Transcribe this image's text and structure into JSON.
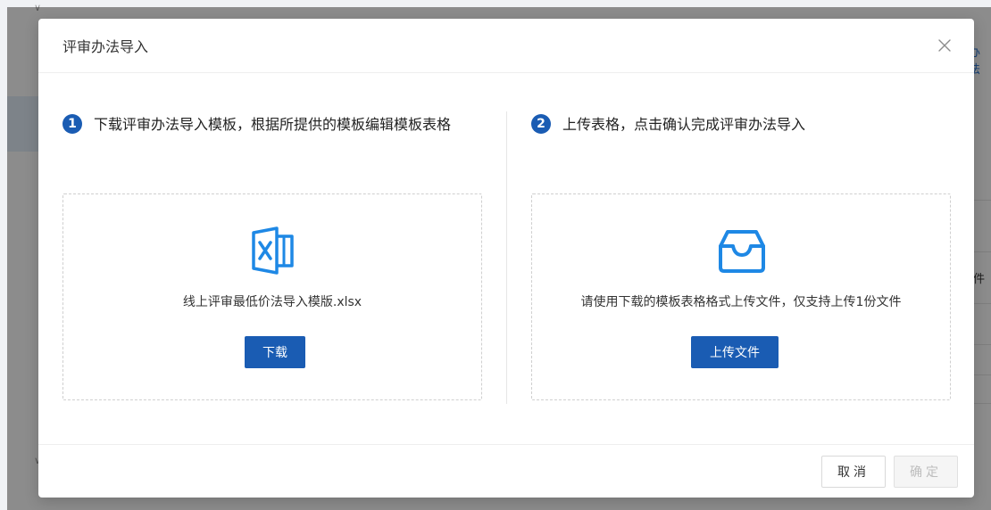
{
  "background": {
    "partial_texts": [
      "办法",
      "件"
    ]
  },
  "modal": {
    "title": "评审办法导入",
    "close_icon": "close-icon",
    "step1": {
      "number": "1",
      "text": "下载评审办法导入模板，根据所提供的模板编辑模板表格",
      "icon": "excel-file-icon",
      "caption": "线上评审最低价法导入模版.xlsx",
      "button_label": "下载"
    },
    "step2": {
      "number": "2",
      "text": "上传表格，点击确认完成评审办法导入",
      "icon": "inbox-tray-icon",
      "caption": "请使用下载的模板表格格式上传文件，仅支持上传1份文件",
      "button_label": "上传文件"
    },
    "footer": {
      "cancel_label": "取消",
      "ok_label": "确定",
      "ok_disabled": true
    }
  },
  "colors": {
    "primary": "#1a5cb3",
    "icon_blue": "#1e88e5",
    "mask": "rgba(0,0,0,0.45)"
  }
}
